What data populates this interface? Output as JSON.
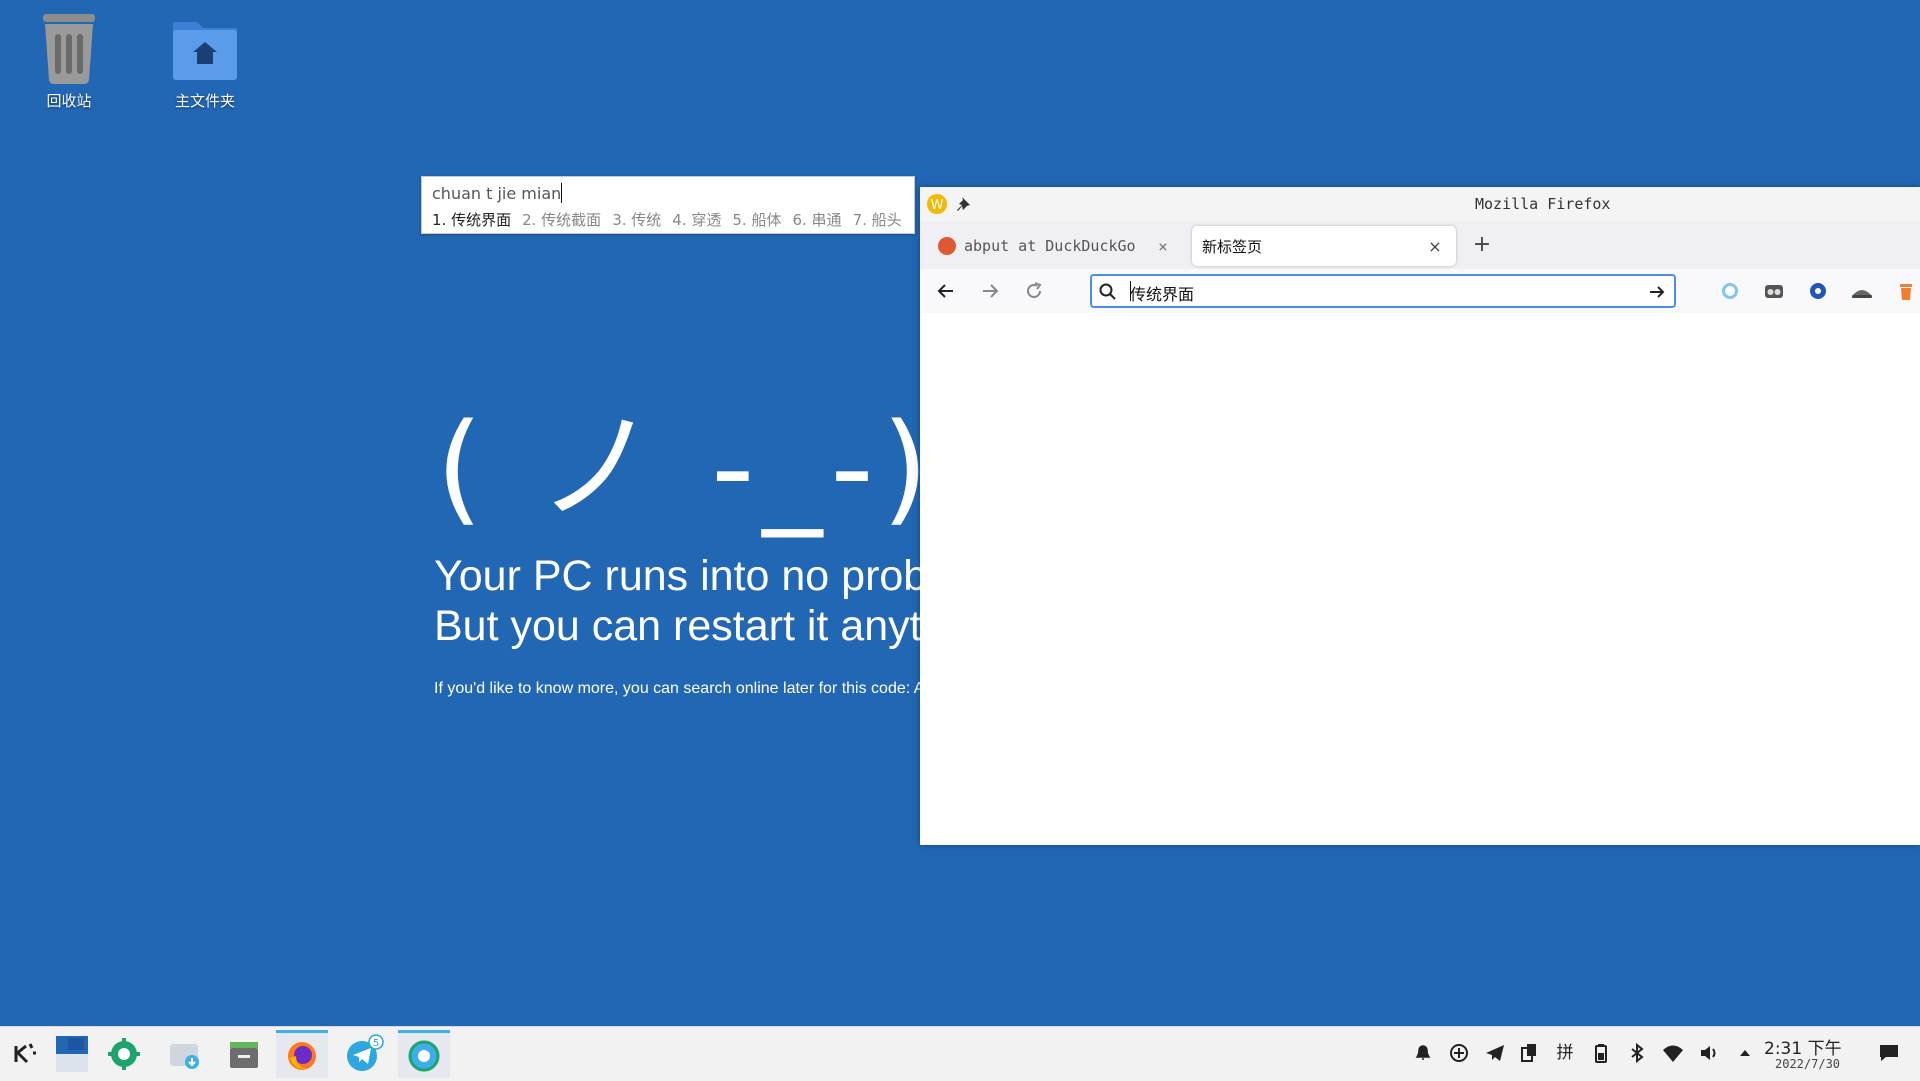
{
  "desktop": {
    "icons": [
      {
        "label": "回收站"
      },
      {
        "label": "主文件夹"
      }
    ],
    "wallpaper": {
      "face": "( ノ -_-) ノ",
      "line1": "Your PC runs into no probler",
      "line2": "But you can restart it anytim",
      "small": "If you'd like to know more, you can search online later for this code: A"
    }
  },
  "ime": {
    "preedit": "chuan t jie mian",
    "candidates": [
      "1. 传统界面",
      "2. 传统截面",
      "3. 传统",
      "4. 穿透",
      "5. 船体",
      "6. 串通",
      "7. 船头"
    ]
  },
  "firefox": {
    "window_title": "Mozilla Firefox",
    "tabs": [
      {
        "title": "abput at DuckDuckGo",
        "active": false
      },
      {
        "title": "新标签页",
        "active": true
      }
    ],
    "url_text": "传统界面",
    "new_tab_glyph": "+",
    "close_glyph": "×"
  },
  "taskbar": {
    "clock_time": "2:31 下午",
    "clock_date": "2022/7/30",
    "telegram_badge": "5",
    "ime_indicator": "拼"
  },
  "colors": {
    "desktop_bg": "#2267b3",
    "accent": "#4a90e2",
    "taskbar_bg": "#f2f2f2"
  }
}
